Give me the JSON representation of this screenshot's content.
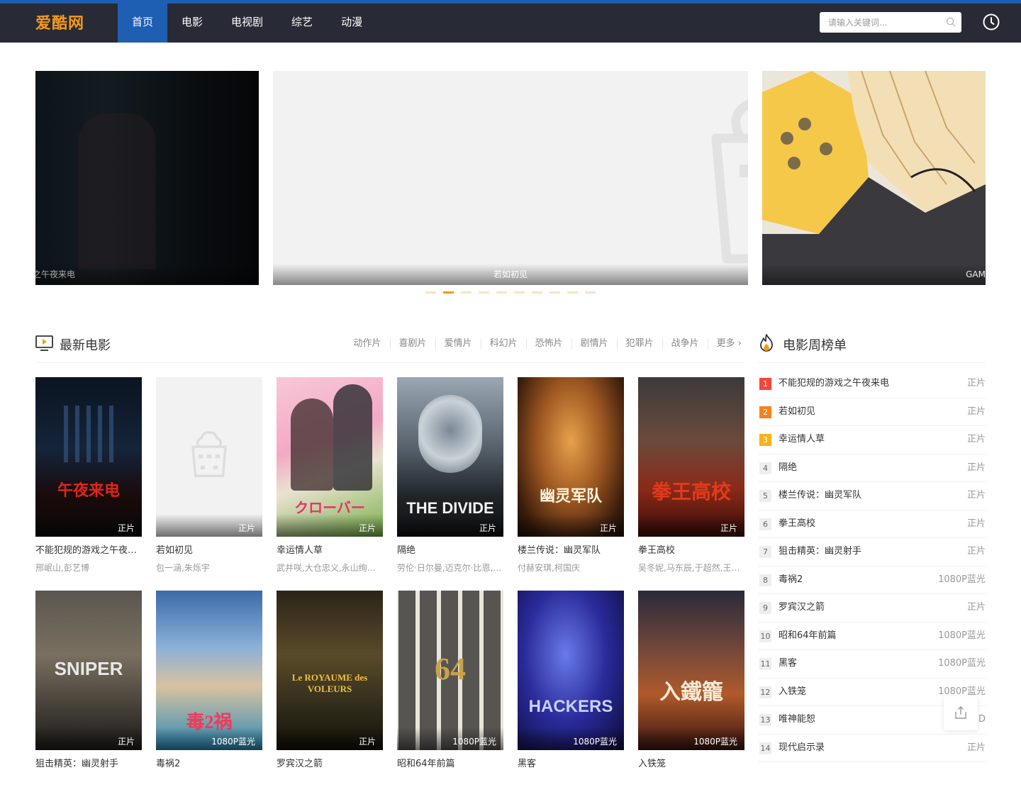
{
  "header": {
    "logo": "爱酷网",
    "nav": [
      "首页",
      "电影",
      "电视剧",
      "综艺",
      "动漫"
    ],
    "active_nav": "首页",
    "search_placeholder": "请输入关键词..."
  },
  "banner": {
    "slides": [
      {
        "caption": "之午夜来电"
      },
      {
        "caption": "若如初见"
      },
      {
        "caption": "GAM"
      }
    ],
    "dot_count": 10,
    "active_dot": 2
  },
  "latest": {
    "title": "最新电影",
    "categories": [
      "动作片",
      "喜剧片",
      "爱情片",
      "科幻片",
      "恐怖片",
      "剧情片",
      "犯罪片",
      "战争片",
      "更多"
    ],
    "movies": [
      {
        "title": "不能犯规的游戏之午夜来电",
        "actors": "邢岷山,彭艺博",
        "badge": "正片",
        "poster_text": "午夜来电"
      },
      {
        "title": "若如初见",
        "actors": "包一涵,朱烁宇",
        "badge": "正片",
        "poster_text": ""
      },
      {
        "title": "幸运情人草",
        "actors": "武井咲,大仓忠义,永山绚斗,夏帆",
        "badge": "正片",
        "poster_text": "クローバー"
      },
      {
        "title": "隔绝",
        "actors": "劳伦·日尔曼,迈克尔·比恩,米洛",
        "badge": "正片",
        "poster_text": "THE DIVIDE"
      },
      {
        "title": "楼兰传说：幽灵军队",
        "actors": "付赫安琪,柯国庆",
        "badge": "正片",
        "poster_text": "幽灵军队"
      },
      {
        "title": "拳王高校",
        "actors": "吴冬妮,马东辰,于超然,王一博",
        "badge": "正片",
        "poster_text": "拳王高校"
      },
      {
        "title": "狙击精英：幽灵射手",
        "actors": "",
        "badge": "正片",
        "poster_text": "SNIPER"
      },
      {
        "title": "毒祸2",
        "actors": "",
        "badge": "1080P蓝光",
        "poster_text": "毒2祸"
      },
      {
        "title": "罗宾汉之箭",
        "actors": "",
        "badge": "正片",
        "poster_text": "Le ROYAUME des VOLEURS"
      },
      {
        "title": "昭和64年前篇",
        "actors": "",
        "badge": "1080P蓝光",
        "poster_text": "64"
      },
      {
        "title": "黑客",
        "actors": "",
        "badge": "1080P蓝光",
        "poster_text": "HACKERS"
      },
      {
        "title": "入铁笼",
        "actors": "",
        "badge": "1080P蓝光",
        "poster_text": "入鐵籠"
      }
    ]
  },
  "ranking": {
    "title": "电影周榜单",
    "items": [
      {
        "num": "1",
        "name": "不能犯规的游戏之午夜来电",
        "tag": "正片"
      },
      {
        "num": "2",
        "name": "若如初见",
        "tag": "正片"
      },
      {
        "num": "3",
        "name": "幸运情人草",
        "tag": "正片"
      },
      {
        "num": "4",
        "name": "隔绝",
        "tag": "正片"
      },
      {
        "num": "5",
        "name": "楼兰传说：幽灵军队",
        "tag": "正片"
      },
      {
        "num": "6",
        "name": "拳王高校",
        "tag": "正片"
      },
      {
        "num": "7",
        "name": "狙击精英：幽灵射手",
        "tag": "正片"
      },
      {
        "num": "8",
        "name": "毒祸2",
        "tag": "1080P蓝光"
      },
      {
        "num": "9",
        "name": "罗宾汉之箭",
        "tag": "正片"
      },
      {
        "num": "10",
        "name": "昭和64年前篇",
        "tag": "1080P蓝光"
      },
      {
        "num": "11",
        "name": "黑客",
        "tag": "1080P蓝光"
      },
      {
        "num": "12",
        "name": "入铁笼",
        "tag": "1080P蓝光"
      },
      {
        "num": "13",
        "name": "唯神能恕",
        "tag": "D"
      },
      {
        "num": "14",
        "name": "现代启示录",
        "tag": "正片"
      }
    ]
  },
  "colors": {
    "accent": "#1e5fb4",
    "brand": "#f39a1d",
    "header_bg": "#282a36"
  }
}
